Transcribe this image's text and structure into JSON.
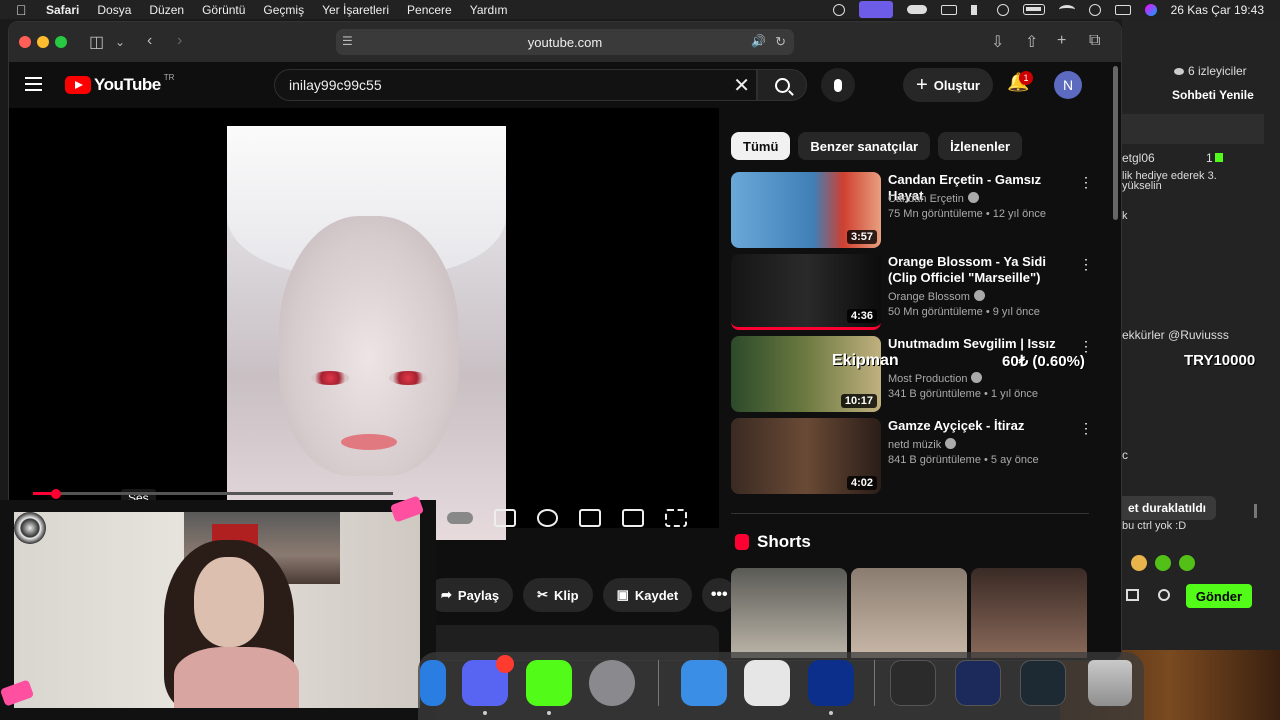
{
  "menubar": {
    "apple": "",
    "app": "Safari",
    "items": [
      "Dosya",
      "Düzen",
      "Görüntü",
      "Geçmiş",
      "Yer İşaretleri",
      "Pencere",
      "Yardım"
    ],
    "clock": "26 Kas Çar  19:43"
  },
  "safari": {
    "url": "youtube.com"
  },
  "youtube": {
    "logo_text": "YouTube",
    "country": "TR",
    "search_value": "inilay99c99c55",
    "create_label": "Oluştur",
    "notif_count": "1",
    "avatar_initial": "N"
  },
  "player": {
    "volume_tooltip": "Ses",
    "progress_fraction": 0.07
  },
  "actions": {
    "share": "Paylaş",
    "clip": "Klip",
    "save": "Kaydet",
    "more": "•••"
  },
  "chips": [
    "Tümü",
    "Benzer sanatçılar",
    "İzlenenler"
  ],
  "related": [
    {
      "title": "Candan Erçetin - Gamsız Hayat",
      "channel": "Candan Erçetin",
      "meta": "75 Mn görüntüleme • 12 yıl önce",
      "duration": "3:57"
    },
    {
      "title": "Orange Blossom - Ya Sidi (Clip Officiel \"Marseille\")",
      "channel": "Orange Blossom",
      "meta": "50 Mn görüntüleme • 9 yıl önce",
      "duration": "4:36"
    },
    {
      "title": "Unutmadım Sevgilim | Issız",
      "channel": "Most Production",
      "meta": "341 B görüntüleme • 1 yıl önce",
      "duration": "10:17"
    },
    {
      "title": "Gamze Ayçiçek - İtiraz",
      "channel": "netd müzik",
      "meta": "841 B görüntüleme • 5 ay önce",
      "duration": "4:02"
    }
  ],
  "shorts_title": "Shorts",
  "overlay": {
    "name": "Ekipman",
    "percent": "60₺ (0.60%)",
    "amount": "TRY10000"
  },
  "chat": {
    "viewers": "6 izleyiciler",
    "refresh": "Sohbeti Yenile",
    "user": "etgl06",
    "user_count": "1",
    "line1": "lik hediye ederek 3.",
    "line2": "yükselin",
    "line3": "k",
    "line4": "ekkürler @Ruviusss",
    "line5": "c",
    "paused": "et duraklatıldı",
    "line6": "bu ctrl yok :D",
    "send": "Gönder"
  },
  "colors": {
    "youtube_red": "#ff0000",
    "kick_green": "#53fc18",
    "chip_active": "#f1f1f1"
  }
}
